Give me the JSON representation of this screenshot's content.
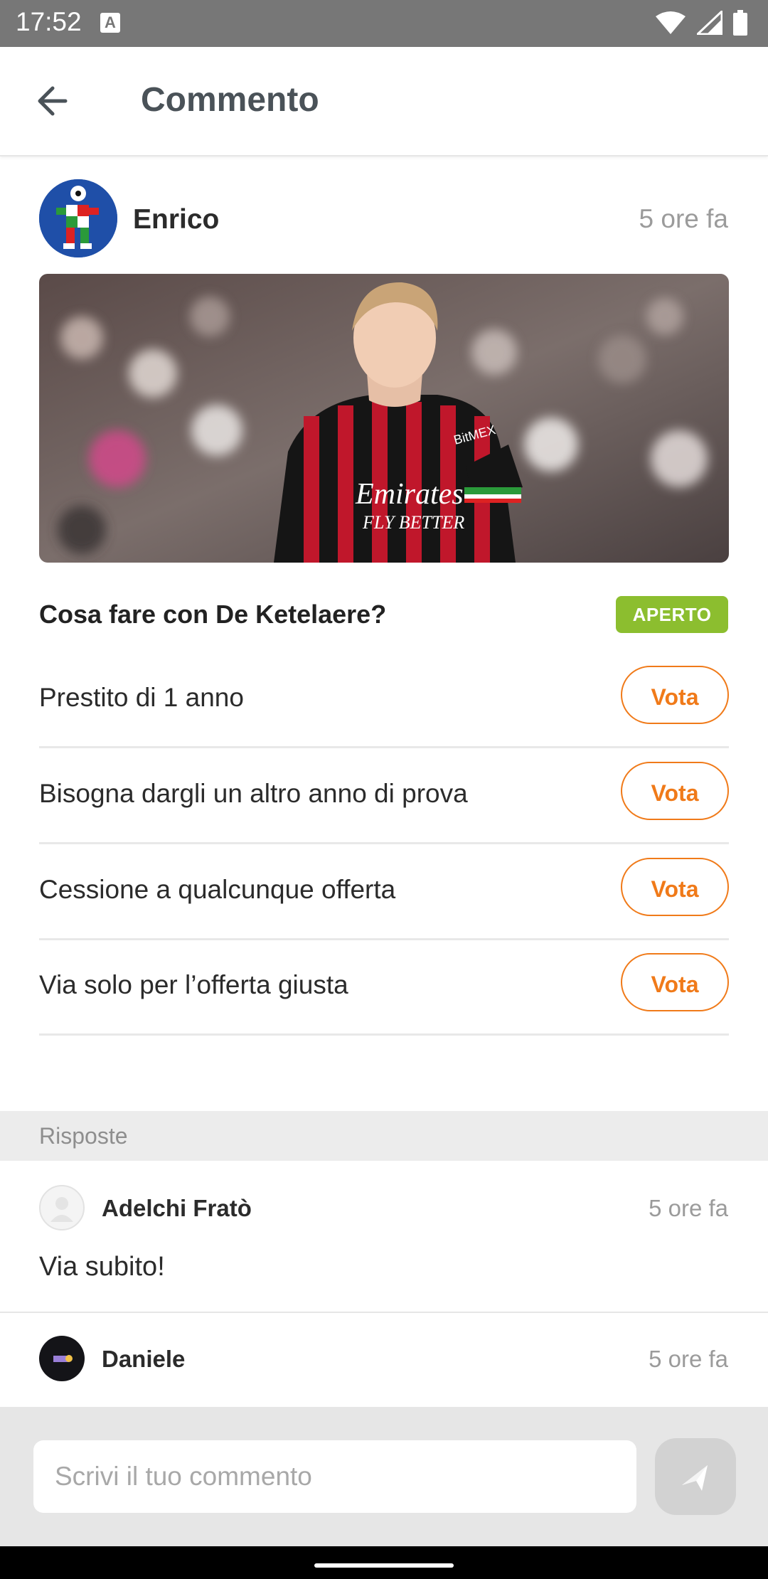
{
  "status_bar": {
    "time": "17:52",
    "notification_icon": "A",
    "icons": [
      "wifi-icon",
      "signal-icon",
      "battery-icon"
    ]
  },
  "app_bar": {
    "title": "Commento",
    "back_icon": "arrow-left-icon"
  },
  "post": {
    "author": "Enrico",
    "time": "5 ore fa",
    "image_caption": {
      "sponsor_line1": "Emirates",
      "sponsor_line2": "FLY BETTER",
      "sleeve_sponsor": "BitMEX"
    },
    "poll": {
      "question": "Cosa fare con De Ketelaere?",
      "status": "APERTO",
      "options": [
        {
          "label": "Prestito di 1 anno",
          "button": "Vota"
        },
        {
          "label": "Bisogna dargli un altro anno di prova",
          "button": "Vota"
        },
        {
          "label": "Cessione a qualcunque offerta",
          "button": "Vota"
        },
        {
          "label": "Via solo per l’offerta giusta",
          "button": "Vota"
        }
      ]
    }
  },
  "answers": {
    "header": "Risposte",
    "items": [
      {
        "author": "Adelchi Fratò",
        "time": "5 ore fa",
        "text": "Via subito!"
      },
      {
        "author": "Daniele",
        "time": "5 ore fa",
        "text": ""
      }
    ]
  },
  "composer": {
    "placeholder": "Scrivi il tuo commento",
    "send_icon": "send-icon"
  },
  "colors": {
    "accent": "#f07a19",
    "open_badge": "#8cbe2f",
    "status_bar": "#777777"
  }
}
